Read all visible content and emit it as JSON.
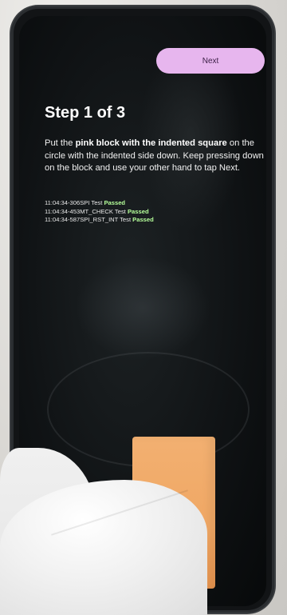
{
  "next_button": {
    "label": "Next"
  },
  "step": {
    "title": "Step 1 of 3"
  },
  "instructions": {
    "seg1": "Put the ",
    "seg2": "pink block with the indented square",
    "seg3": " on the circle with the indented side down. Keep pressing down on the block and use your other hand to tap Next."
  },
  "logs": [
    {
      "text": "11:04:34-306SPI Test ",
      "status": "Passed"
    },
    {
      "text": "11:04:34-453MT_CHECK Test ",
      "status": "Passed"
    },
    {
      "text": "11:04:34-587SPI_RST_INT Test ",
      "status": "Passed"
    }
  ],
  "colors": {
    "button": "#e7b6ee",
    "passed": "#b5ff9a",
    "block": "#f0a764"
  }
}
